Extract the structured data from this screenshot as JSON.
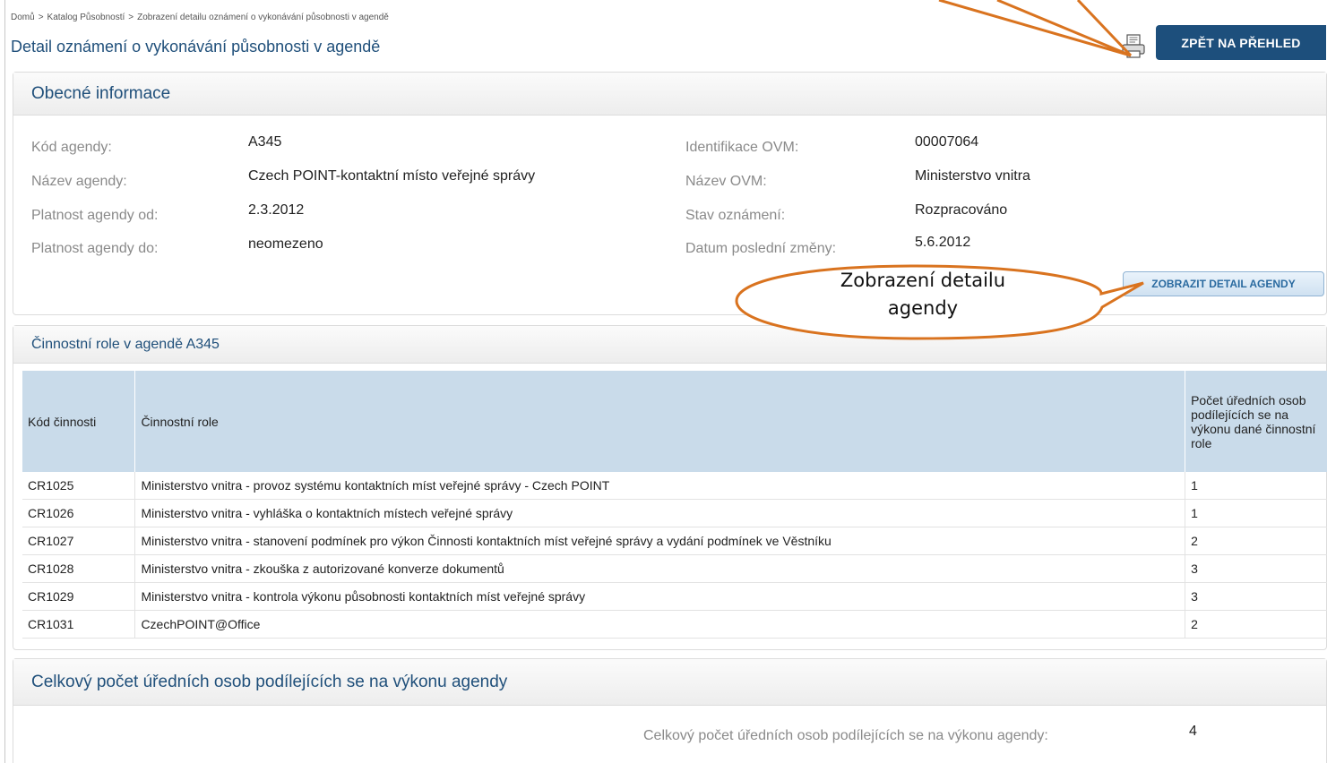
{
  "breadcrumb": [
    "Domů",
    "Katalog Působností",
    "Zobrazení detailu oznámení o vykonávání působnosti v agendě"
  ],
  "breadcrumb_sep": ">",
  "page_title": "Detail oznámení o vykonávání působnosti v agendě",
  "back_button": "ZPĚT NA PŘEHLED",
  "icons": {
    "print": "print-icon"
  },
  "general": {
    "title": "Obecné informace",
    "left": [
      {
        "label": "Kód agendy:",
        "value": "A345"
      },
      {
        "label": "Název agendy:",
        "value": "Czech POINT-kontaktní místo veřejné správy"
      },
      {
        "label": "Platnost agendy od:",
        "value": "2.3.2012"
      },
      {
        "label": "Platnost agendy do:",
        "value": "neomezeno"
      }
    ],
    "right": [
      {
        "label": "Identifikace OVM:",
        "value": "00007064"
      },
      {
        "label": "Název OVM:",
        "value": "Ministerstvo vnitra"
      },
      {
        "label": "Stav oznámení:",
        "value": "Rozpracováno"
      },
      {
        "label": "Datum poslední změny:",
        "value": "5.6.2012"
      }
    ],
    "detail_button": "ZOBRAZIT DETAIL AGENDY"
  },
  "roles": {
    "title": "Činnostní role v agendě A345",
    "headers": [
      "Kód činnosti",
      "Činnostní role",
      "Počet úředních osob podílejících se na výkonu dané činnostní role"
    ],
    "rows": [
      [
        "CR1025",
        "Ministerstvo vnitra - provoz systému kontaktních míst veřejné správy - Czech POINT",
        "1"
      ],
      [
        "CR1026",
        "Ministerstvo vnitra - vyhláška o kontaktních místech veřejné správy",
        "1"
      ],
      [
        "CR1027",
        "Ministerstvo vnitra - stanovení podmínek pro výkon Činnosti kontaktních míst veřejné správy a vydání podmínek ve Věstníku",
        "2"
      ],
      [
        "CR1028",
        "Ministerstvo vnitra - zkouška z autorizované konverze dokumentů",
        "3"
      ],
      [
        "CR1029",
        "Ministerstvo vnitra - kontrola výkonu působnosti kontaktních míst veřejné správy",
        "3"
      ],
      [
        "CR1031",
        "CzechPOINT@Office",
        "2"
      ]
    ]
  },
  "total": {
    "title": "Celkový počet úředních osob podílejících se na výkonu agendy",
    "label": "Celkový počet úředních osob podílejících se na výkonu agendy:",
    "value": "4"
  },
  "callout": {
    "lines": [
      "Zobrazení detailu",
      "agendy"
    ]
  },
  "colors": {
    "accent": "#1d4f7c",
    "callout_stroke": "#d9731f",
    "table_header": "#c9dbea"
  }
}
